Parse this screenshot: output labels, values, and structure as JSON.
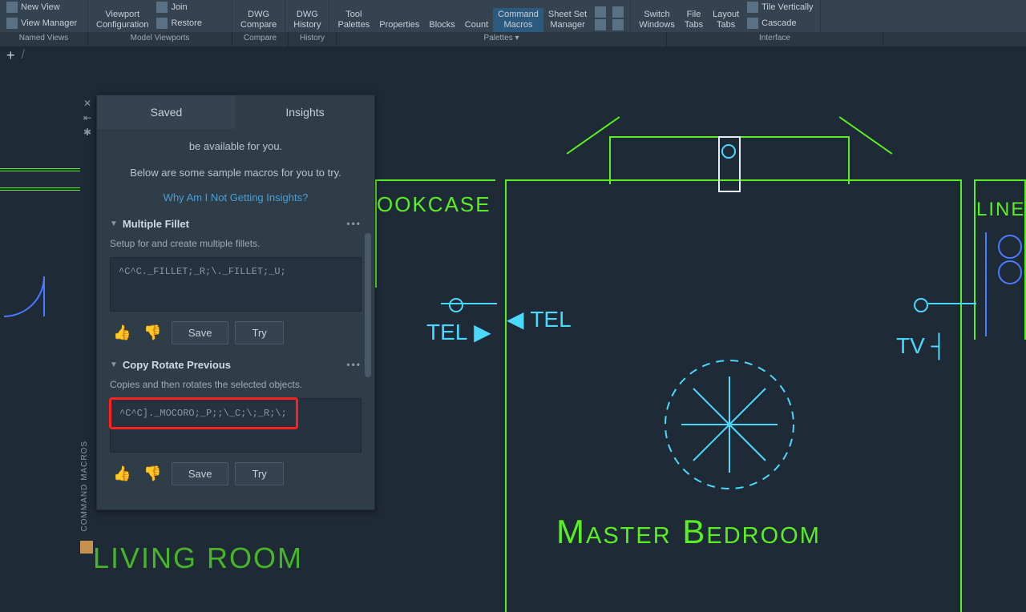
{
  "ribbon": {
    "newView": "New View",
    "viewManager": "View Manager",
    "viewportConfig": "Viewport\nConfiguration",
    "join": "Join",
    "restore": "Restore",
    "dwgCompare": "DWG\nCompare",
    "dwgHistory": "DWG\nHistory",
    "toolPalettes": "Tool\nPalettes",
    "properties": "Properties",
    "blocks": "Blocks",
    "count": "Count",
    "commandMacros": "Command\nMacros",
    "sheetSetMgr": "Sheet Set\nManager",
    "switchWindows": "Switch\nWindows",
    "fileTabs": "File\nTabs",
    "layoutTabs": "Layout\nTabs",
    "tileVert": "Tile Vertically",
    "cascade": "Cascade"
  },
  "ribbonGroups": {
    "namedViews": "Named Views",
    "modelViewports": "Model Viewports",
    "compare": "Compare",
    "history": "History",
    "palettes": "Palettes ▾",
    "interface": "Interface"
  },
  "panel": {
    "tabSaved": "Saved",
    "tabInsights": "Insights",
    "partialText": "be available for you.",
    "belowText": "Below are some sample macros for you to try.",
    "whyLink": "Why Am I Not Getting Insights?",
    "verticalLabel": "COMMAND MACROS"
  },
  "macros": [
    {
      "title": "Multiple Fillet",
      "desc": "Setup for and create multiple fillets.",
      "code": "^C^C._FILLET;_R;\\._FILLET;_U;",
      "saveLabel": "Save",
      "tryLabel": "Try"
    },
    {
      "title": "Copy Rotate Previous",
      "desc": "Copies and then rotates the selected objects.",
      "code": "^C^C]._MOCORO;_P;;\\_C;\\;_R;\\;",
      "saveLabel": "Save",
      "tryLabel": "Try"
    }
  ],
  "drawing": {
    "bookcase": "OOKCASE",
    "tel1": "TEL",
    "tel2": "TEL",
    "tv": "TV",
    "masterBedroom": "Master Bedroom",
    "livingRoom": "LIVING ROOM",
    "linen": "LINEN"
  }
}
